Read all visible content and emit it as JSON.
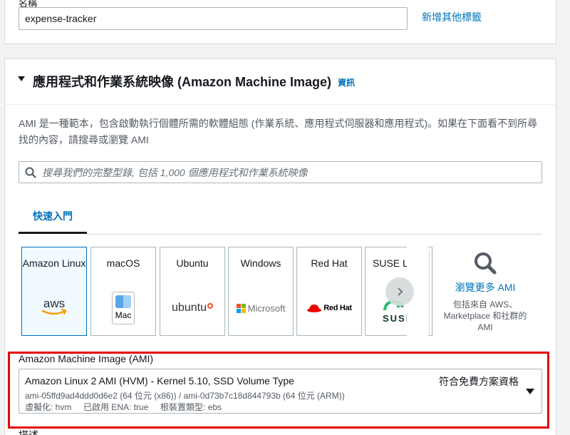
{
  "name_section": {
    "label": "名稱",
    "value": "expense-tracker",
    "add_tags_link": "新增其他標籤"
  },
  "ami_section": {
    "title": "應用程式和作業系統映像 (Amazon Machine Image)",
    "info_link": "資訊",
    "description": "AMI 是一種範本，包含啟動執行個體所需的軟體組態 (作業系統、應用程式伺服器和應用程式)。如果在下面看不到所尋找的內容，請搜尋或瀏覽 AMI",
    "search_placeholder": "搜尋我們的完整型錄, 包括 1,000 個應用程式和作業系統映像",
    "tab_quick_start": "快速入門",
    "tiles": [
      {
        "name": "Amazon Linux",
        "logo": "aws-logo",
        "selected": true
      },
      {
        "name": "macOS",
        "logo": "mac-logo",
        "logo_text": "Mac"
      },
      {
        "name": "Ubuntu",
        "logo": "ubuntu-logo",
        "logo_text": "ubuntu"
      },
      {
        "name": "Windows",
        "logo": "microsoft-logo",
        "logo_text": "Microsoft"
      },
      {
        "name": "Red Hat",
        "logo": "redhat-logo",
        "logo_text": "Red Hat"
      },
      {
        "name": "SUSE Li",
        "logo": "suse-logo",
        "logo_text": "SUSE"
      }
    ],
    "browse_more_link": "瀏覽更多 AMI",
    "browse_more_desc": "包括來自 AWS、Marketplace 和社群的 AMI"
  },
  "ami_select": {
    "label": "Amazon Machine Image (AMI)",
    "selected_title": "Amazon Linux 2 AMI (HVM) - Kernel 5.10, SSD Volume Type",
    "free_tier": "符合免費方案資格",
    "ids": "ami-05ffd9ad4ddd0d6e2 (64 位元 (x86)) / ami-0d73b7c18d844793b (64 位元 (ARM))",
    "meta": "虛擬化: hvm     已啟用 ENA: true     根裝置類型: ebs"
  },
  "next_section_label": "描述",
  "colors": {
    "link": "#0073bb",
    "highlight": "#e50000",
    "selected_tile_bg": "#f1faff"
  }
}
